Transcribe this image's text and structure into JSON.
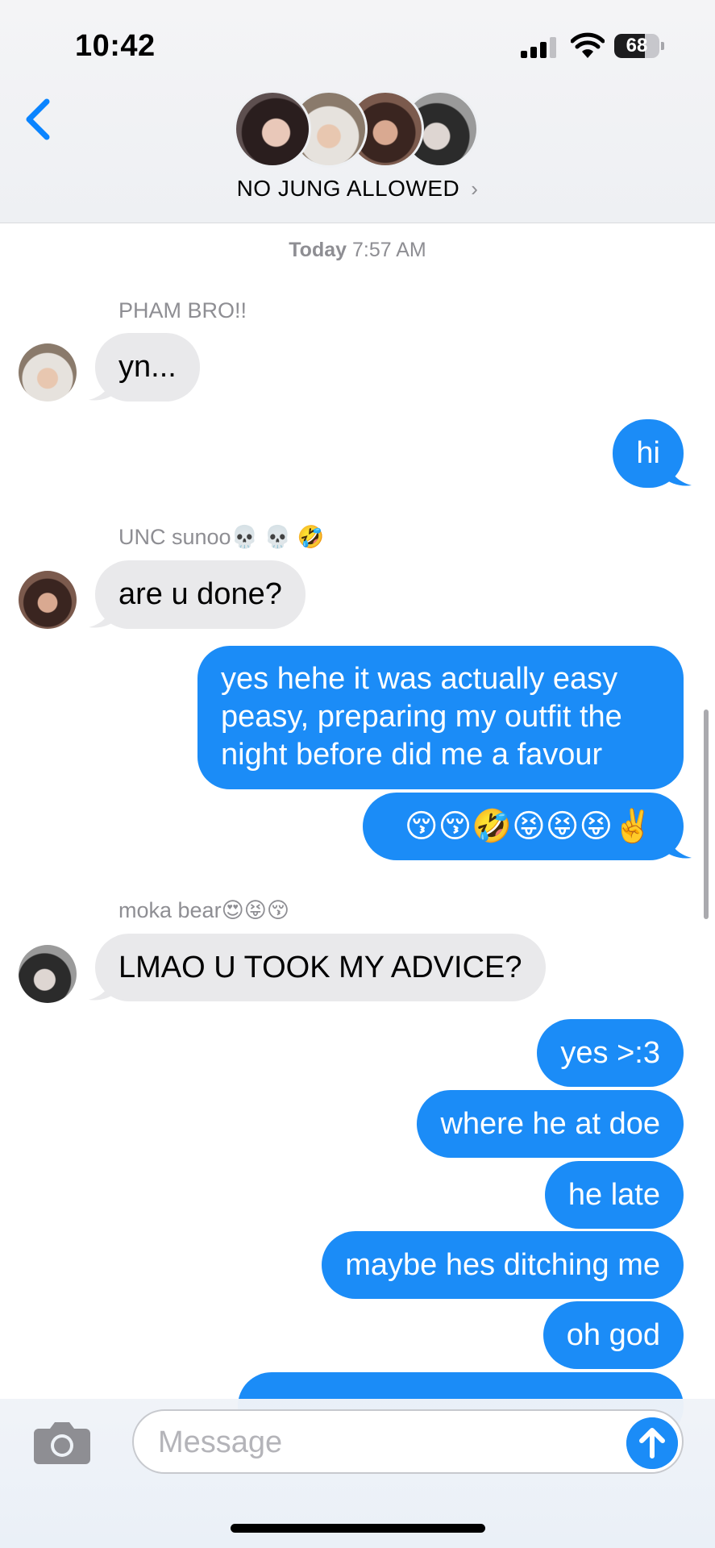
{
  "status_bar": {
    "time": "10:42",
    "battery": "68",
    "battery_fraction": 0.68
  },
  "header": {
    "group_name": "NO JUNG ALLOWED",
    "chevron": "›",
    "back_icon": "chevron-left-icon"
  },
  "conversation": {
    "date_label": "Today",
    "time_label": "7:57 AM",
    "messages": [
      {
        "direction": "in",
        "sender": "PHAM BRO!!",
        "text": "yn..."
      },
      {
        "direction": "out",
        "text": "hi"
      },
      {
        "direction": "in",
        "sender": "UNC sunoo💀 💀 🤣",
        "text": "are u done?"
      },
      {
        "direction": "out",
        "text": "yes hehe it was actually easy peasy, preparing my outfit the night before did me a favour"
      },
      {
        "direction": "out",
        "text": "😚😚🤣😝😝😝✌️"
      },
      {
        "direction": "in",
        "sender": "moka bear😍😝😚",
        "text": "LMAO U TOOK MY ADVICE?"
      },
      {
        "direction": "out",
        "text": "yes >:3"
      },
      {
        "direction": "out",
        "text": "where he at doe"
      },
      {
        "direction": "out",
        "text": "he late"
      },
      {
        "direction": "out",
        "text": "maybe hes ditching me"
      },
      {
        "direction": "out",
        "text": "oh god"
      }
    ]
  },
  "composer": {
    "placeholder": "Message",
    "camera_icon": "camera-icon",
    "send_icon": "arrow-up-icon"
  },
  "colors": {
    "outgoing_bubble": "#1b8cf7",
    "incoming_bubble": "#e9e9eb",
    "accent": "#0a84ff"
  }
}
